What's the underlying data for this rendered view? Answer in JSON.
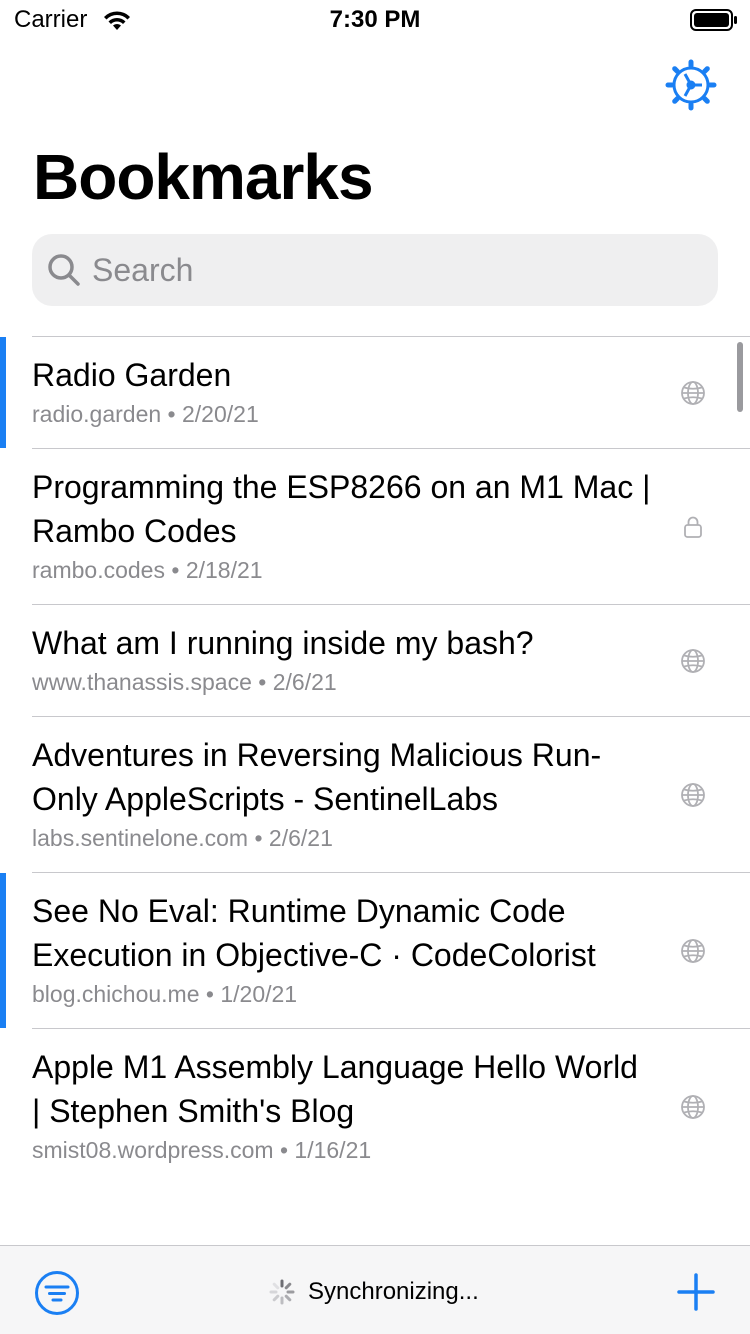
{
  "status_bar": {
    "carrier": "Carrier",
    "time": "7:30 PM"
  },
  "header": {
    "title": "Bookmarks",
    "settings_icon": "gear-icon"
  },
  "search": {
    "placeholder": "Search",
    "value": ""
  },
  "colors": {
    "accent": "#1a7ff3",
    "secondary_text": "#8a8a8e",
    "separator": "#c8c8cc"
  },
  "bookmarks": [
    {
      "title": "Radio Garden",
      "domain": "radio.garden",
      "date": "2/20/21",
      "icon": "globe-icon",
      "unread": true
    },
    {
      "title": "Programming the ESP8266 on an M1 Mac | Rambo Codes",
      "domain": "rambo.codes",
      "date": "2/18/21",
      "icon": "lock-icon",
      "unread": false
    },
    {
      "title": "What am I running inside my bash?",
      "domain": "www.thanassis.space",
      "date": "2/6/21",
      "icon": "globe-icon",
      "unread": false
    },
    {
      "title": "Adventures in Reversing Malicious Run-Only AppleScripts - SentinelLabs",
      "domain": "labs.sentinelone.com",
      "date": "2/6/21",
      "icon": "globe-icon",
      "unread": false
    },
    {
      "title": "See No Eval: Runtime Dynamic Code Execution in Objective-C · CodeColorist",
      "domain": "blog.chichou.me",
      "date": "1/20/21",
      "icon": "globe-icon",
      "unread": true
    },
    {
      "title": "Apple M1 Assembly Language Hello World | Stephen Smith's Blog",
      "domain": "smist08.wordpress.com",
      "date": "1/16/21",
      "icon": "globe-icon",
      "unread": false
    }
  ],
  "toolbar": {
    "filter_icon": "filter-icon",
    "sync_text": "Synchronizing...",
    "add_icon": "plus-icon"
  }
}
